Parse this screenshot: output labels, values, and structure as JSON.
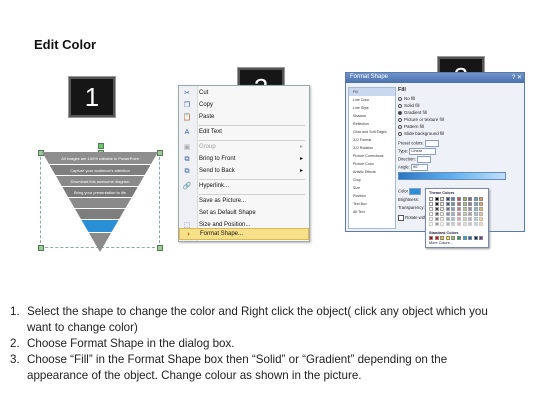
{
  "page": {
    "title": "Edit Color",
    "badges": [
      "1",
      "2",
      "3"
    ]
  },
  "triangle": {
    "bands": [
      "All images are 100% editable in PowerPoint",
      "Capture your audience's attention",
      "Download this awesome diagram",
      "Bring your presentation to life"
    ],
    "colors": {
      "band": "#8a8a8a",
      "band_dark": "#6e6e6e",
      "selected": "#2a8fd6"
    }
  },
  "context_menu": {
    "items": [
      {
        "label": "Cut",
        "icon": "scissors-icon",
        "enabled": true
      },
      {
        "label": "Copy",
        "icon": "copy-icon",
        "enabled": true
      },
      {
        "label": "Paste",
        "icon": "paste-icon",
        "enabled": true
      },
      {
        "label": "Edit Text",
        "icon": "edit-text-icon",
        "enabled": true
      },
      {
        "label": "Group",
        "icon": "group-icon",
        "enabled": false,
        "submenu": true
      },
      {
        "label": "Bring to Front",
        "icon": "bring-front-icon",
        "enabled": true,
        "submenu": true
      },
      {
        "label": "Send to Back",
        "icon": "send-back-icon",
        "enabled": true,
        "submenu": true
      },
      {
        "label": "Hyperlink...",
        "icon": "hyperlink-icon",
        "enabled": true
      },
      {
        "label": "Save as Picture...",
        "icon": "",
        "enabled": true
      },
      {
        "label": "Set as Default Shape",
        "icon": "",
        "enabled": true
      },
      {
        "label": "Size and Position...",
        "icon": "size-icon",
        "enabled": true
      },
      {
        "label": "Format Shape...",
        "icon": "format-shape-icon",
        "enabled": true,
        "highlighted": true
      }
    ]
  },
  "dialog": {
    "title": "Format Shape",
    "sidebar": [
      "Fill",
      "Line Color",
      "Line Style",
      "Shadow",
      "Reflection",
      "Glow and Soft Edges",
      "3-D Format",
      "3-D Rotation",
      "Picture Corrections",
      "Picture Color",
      "Artistic Effects",
      "Crop",
      "Size",
      "Position",
      "Text Box",
      "Alt Text"
    ],
    "heading": "Fill",
    "fill_options": [
      "No fill",
      "Solid fill",
      "Gradient fill",
      "Picture or texture fill",
      "Pattern fill",
      "Slide background fill"
    ],
    "selected_option": "Gradient fill",
    "fields": [
      "Preset colors:",
      "Type:",
      "Direction:",
      "Angle:",
      "Gradient stops",
      "Color",
      "Position:",
      "Brightness:",
      "Transparency:"
    ],
    "angle_value": "90°",
    "type_value": "Linear",
    "popup": {
      "theme_label": "Theme Colors",
      "standard_label": "Standard Colors",
      "more_label": "More Colors..."
    },
    "checkbox_label": "Rotate with shape"
  },
  "instructions": [
    {
      "num": "1.",
      "lines": [
        "Select the shape to change the color and Right click the object( click any object which you",
        "want to change color)"
      ]
    },
    {
      "num": "2.",
      "lines": [
        "Choose Format Shape in the dialog box."
      ]
    },
    {
      "num": "3.",
      "lines": [
        "Choose “Fill” in the Format Shape box then “Solid” or “Gradient” depending on the",
        "appearance of the object. Change colour as shown in the picture."
      ]
    }
  ]
}
